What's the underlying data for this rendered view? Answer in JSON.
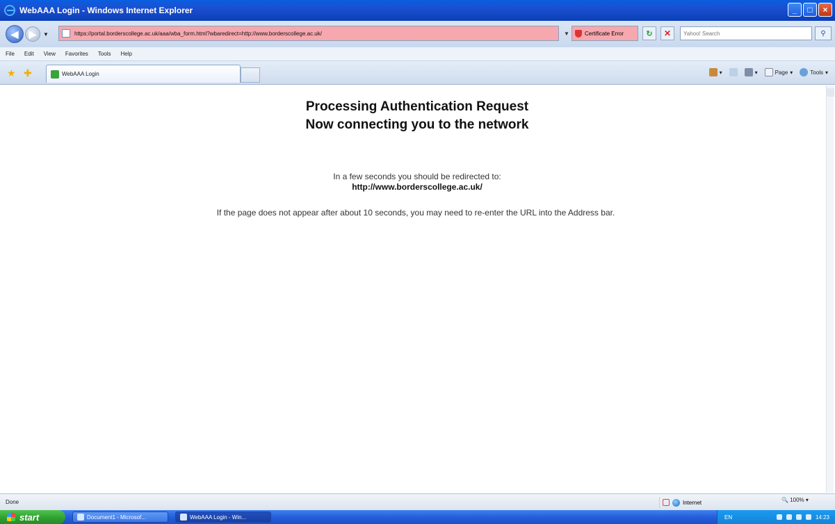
{
  "window": {
    "title": "WebAAA Login - Windows Internet Explorer",
    "buttons": [
      "_",
      "□",
      "×"
    ]
  },
  "address": {
    "url": "https://portal.borderscollege.ac.uk/aaa/wba_form.html?wbaredirect=http://www.borderscollege.ac.uk/",
    "cert_error": "Certificate Error",
    "search_placeholder": "Yahoo! Search"
  },
  "menu": [
    "File",
    "Edit",
    "View",
    "Favorites",
    "Tools",
    "Help"
  ],
  "tab": {
    "label": "WebAAA Login"
  },
  "toolbar_right": {
    "page": "Page",
    "tools": "Tools"
  },
  "content": {
    "heading1": "Processing Authentication Request",
    "heading2": "Now connecting you to the network",
    "redirect_line": "In a few seconds you should be redirected to:",
    "redirect_url": "http://www.borderscollege.ac.uk/",
    "note": "If the page does not appear after about 10 seconds, you may need to re-enter the URL into the Address bar."
  },
  "status": {
    "text": "Done",
    "zone": "Internet",
    "zoom": "100%"
  },
  "taskbar": {
    "start": "start",
    "tasks": [
      "Document1 - Microsof...",
      "WebAAA Login - Win..."
    ],
    "lang": "EN",
    "clock": "14:23"
  },
  "colors": {
    "titlebar": "#0a5fe0",
    "cert_error_bg": "#f6a8ae",
    "taskbar": "#245edb",
    "start_button": "#2e9e2e"
  }
}
